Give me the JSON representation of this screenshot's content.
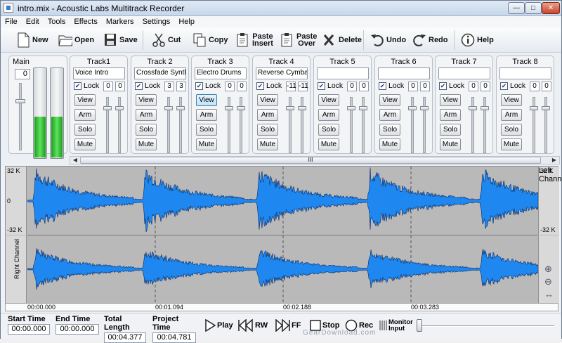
{
  "window": {
    "title": "intro.mix - Acoustic Labs Multitrack Recorder",
    "min": "—",
    "max": "□",
    "close": "✕"
  },
  "menu": [
    "File",
    "Edit",
    "Tools",
    "Effects",
    "Markers",
    "Settings",
    "Help"
  ],
  "toolbar": {
    "new": "New",
    "open": "Open",
    "save": "Save",
    "cut": "Cut",
    "copy": "Copy",
    "paste_insert_1": "Paste",
    "paste_insert_2": "Insert",
    "paste_over_1": "Paste",
    "paste_over_2": "Over",
    "delete": "Delete",
    "undo": "Undo",
    "redo": "Redo",
    "help": "Help"
  },
  "main": {
    "label": "Main",
    "value": "0",
    "meter_left": 0.45,
    "meter_right": 0.45
  },
  "tracks": [
    {
      "title": "Track1",
      "name": "Voice Intro",
      "lock_label": "Lock",
      "locked": true,
      "v1": "0",
      "v2": "0"
    },
    {
      "title": "Track 2",
      "name": "Crossfade Synth",
      "lock_label": "Lock",
      "locked": true,
      "v1": "3",
      "v2": "3"
    },
    {
      "title": "Track 3",
      "name": "Electro Drums",
      "lock_label": "Lock",
      "locked": true,
      "v1": "0",
      "v2": "0"
    },
    {
      "title": "Track 4",
      "name": "Reverse Cymbal F",
      "lock_label": "Lock",
      "locked": true,
      "v1": "-11",
      "v2": "-11"
    },
    {
      "title": "Track 5",
      "name": "",
      "lock_label": "Lock",
      "locked": true,
      "v1": "0",
      "v2": "0"
    },
    {
      "title": "Track 6",
      "name": "",
      "lock_label": "Lock",
      "locked": true,
      "v1": "0",
      "v2": "0"
    },
    {
      "title": "Track 7",
      "name": "",
      "lock_label": "Lock",
      "locked": true,
      "v1": "0",
      "v2": "0"
    },
    {
      "title": "Track 8",
      "name": "",
      "lock_label": "Lock",
      "locked": true,
      "v1": "0",
      "v2": "0"
    }
  ],
  "strip_buttons": {
    "view": "View",
    "arm": "Arm",
    "solo": "Solo",
    "mute": "Mute"
  },
  "scroll_grip": "III",
  "waveform": {
    "left_label": "Left Channel",
    "right_label": "Right Channel",
    "top": "32 K",
    "mid": "0",
    "bottom": "-32 K",
    "color": "#1e88f0"
  },
  "zoom": {
    "in": "⊕",
    "out": "⊖",
    "fit": "↔"
  },
  "timeline": [
    "00:00.000",
    "00:01.094",
    "00:02.188",
    "00:03.283"
  ],
  "transport": {
    "start_label": "Start Time",
    "start": "00:00.000",
    "end_label": "End Time",
    "end": "00:00.000",
    "total_label": "Total Length",
    "total": "00:04.377",
    "project_label": "Project Time",
    "project": "00:04.781",
    "play": "Play",
    "rw": "RW",
    "ff": "FF",
    "stop": "Stop",
    "rec": "Rec",
    "monitor_1": "Monitor",
    "monitor_2": "Input"
  },
  "watermark": "GearDownload.com"
}
